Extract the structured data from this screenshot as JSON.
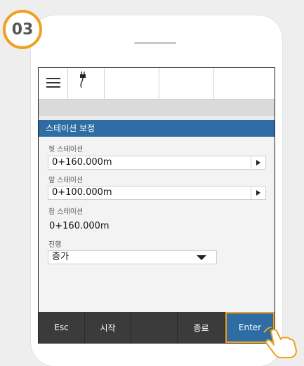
{
  "step_badge": "03",
  "panel_title": "스테이션 보정",
  "back_station": {
    "label": "뒷 스테이션",
    "value": "0+160.000m"
  },
  "front_station": {
    "label": "앞 스테이션",
    "value": "0+100.000m"
  },
  "true_station": {
    "label": "참 스테이션",
    "value": "0+160.000m"
  },
  "direction": {
    "label": "진행",
    "value": "증가"
  },
  "buttons": {
    "esc": "Esc",
    "start": "시작",
    "end": "종료",
    "enter": "Enter"
  },
  "icons": {
    "menu": "hamburger-menu-icon",
    "power": "plug-icon",
    "pointer": "tapping-hand-icon"
  },
  "colors": {
    "accent_blue": "#2d6da3",
    "highlight_orange": "#f0a020"
  }
}
